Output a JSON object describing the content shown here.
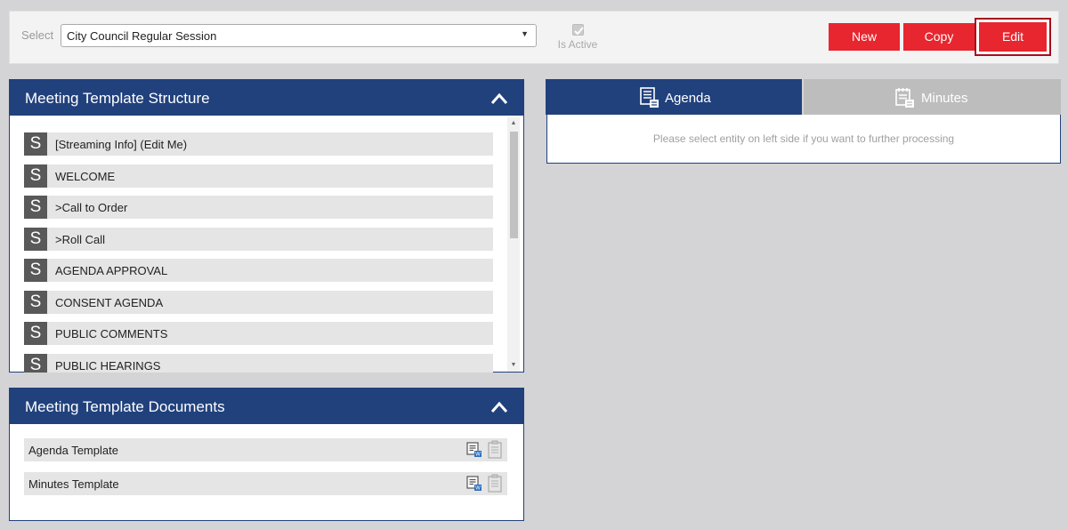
{
  "toolbar": {
    "select_label": "Select",
    "template_value": "City Council Regular Session",
    "is_active_label": "Is Active",
    "is_active_checked": true,
    "new_label": "New",
    "copy_label": "Copy",
    "edit_label": "Edit"
  },
  "structure_panel": {
    "title": "Meeting Template Structure",
    "items": [
      {
        "badge": "S",
        "label": "[Streaming Info] (Edit Me)"
      },
      {
        "badge": "S",
        "label": "WELCOME"
      },
      {
        "badge": "S",
        "label": ">Call to Order"
      },
      {
        "badge": "S",
        "label": ">Roll Call"
      },
      {
        "badge": "S",
        "label": "AGENDA APPROVAL"
      },
      {
        "badge": "S",
        "label": "CONSENT AGENDA"
      },
      {
        "badge": "S",
        "label": "PUBLIC COMMENTS"
      },
      {
        "badge": "S",
        "label": "PUBLIC HEARINGS"
      }
    ]
  },
  "documents_panel": {
    "title": "Meeting Template Documents",
    "items": [
      {
        "label": "Agenda Template"
      },
      {
        "label": "Minutes Template"
      }
    ]
  },
  "tabs": {
    "agenda_label": "Agenda",
    "minutes_label": "Minutes",
    "empty_message": "Please select entity on left side if you want to further processing"
  },
  "colors": {
    "primary": "#21417d",
    "accent": "#e8262f",
    "tab_inactive": "#bdbdbd"
  }
}
